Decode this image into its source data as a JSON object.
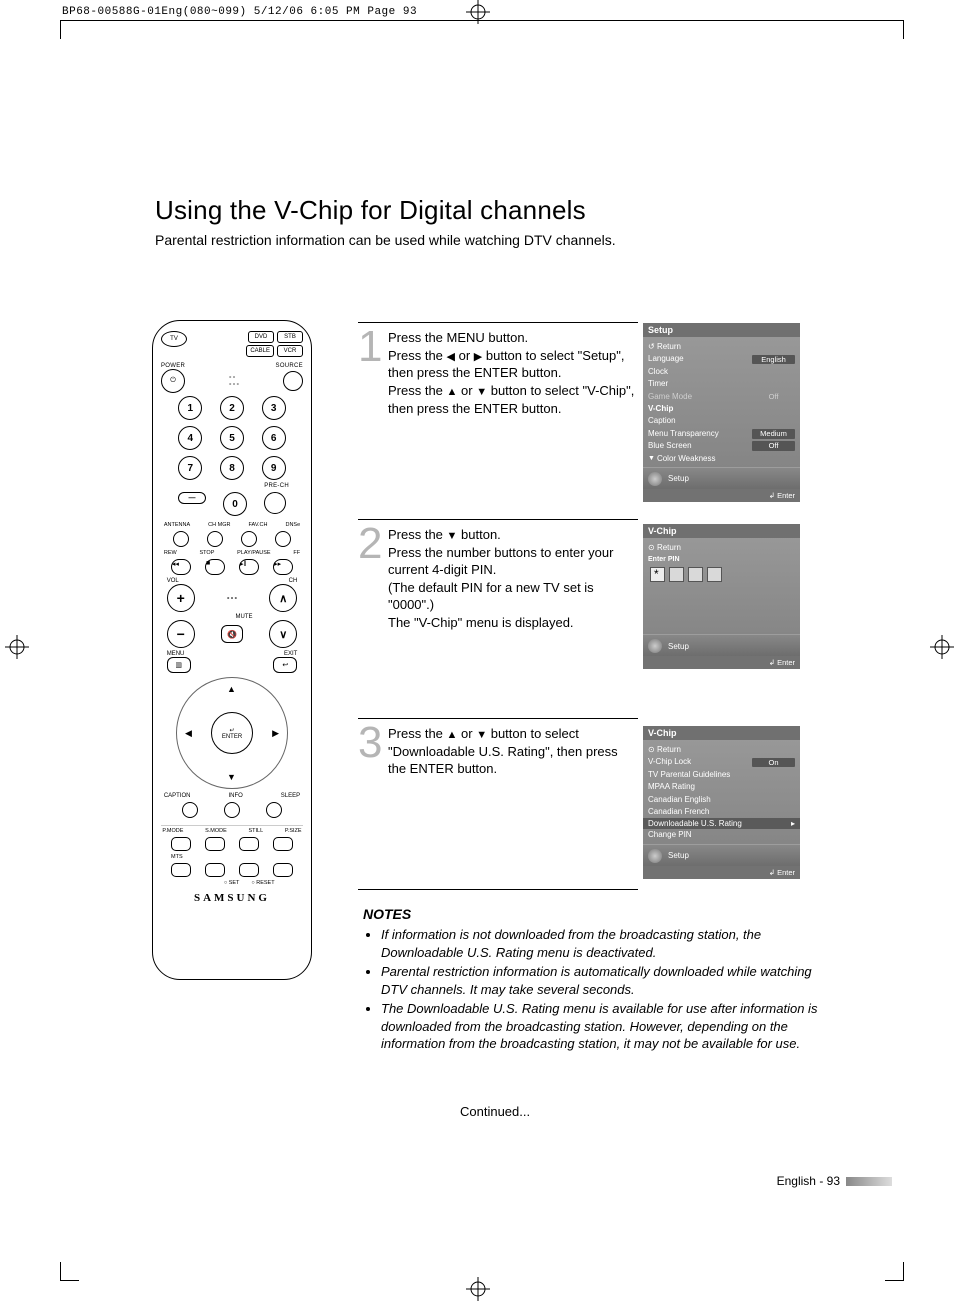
{
  "header": {
    "slug": "BP68-00588G-01Eng(080~099)  5/12/06  6:05 PM  Page 93"
  },
  "title": "Using the V-Chip for Digital channels",
  "subtitle": "Parental restriction information can be used while watching DTV channels.",
  "remote": {
    "tv": "TV",
    "dvd": "DVD",
    "stb": "STB",
    "cable": "CABLE",
    "vcr": "VCR",
    "power": "POWER",
    "source": "SOURCE",
    "prech": "PRE-CH",
    "row_small": {
      "antenna": "ANTENNA",
      "chmgr": "CH MGR",
      "favch": "FAV.CH",
      "dnse": "DNSe"
    },
    "transport": {
      "rew": "REW",
      "stop": "STOP",
      "playpause": "PLAY/PAUSE",
      "ff": "FF"
    },
    "vol": "VOL",
    "ch": "CH",
    "mute": "MUTE",
    "menu": "MENU",
    "exit": "EXIT",
    "enter": "ENTER",
    "caption": "CAPTION",
    "info": "INFO",
    "sleep": "SLEEP",
    "pmode": "P.MODE",
    "smode": "S.MODE",
    "still": "STILL",
    "psize": "P.SIZE",
    "mts": "MTS",
    "set": "SET",
    "reset": "RESET",
    "brand": "SAMSUNG"
  },
  "steps": {
    "s1_num": "1",
    "s1_l1": "Press the MENU button.",
    "s1_l2a": "Press the ",
    "s1_l2b": " or ",
    "s1_l2c": " button to select \"Setup\", then press the ENTER button.",
    "s1_l3a": "Press the ",
    "s1_l3b": " or ",
    "s1_l3c": " button to select \"V-Chip\", then press the ENTER button.",
    "s2_num": "2",
    "s2_l1a": "Press the ",
    "s2_l1b": " button.",
    "s2_l2": "Press the number buttons to enter your current 4-digit PIN.",
    "s2_l3": "(The default PIN for a new TV set is \"0000\".)",
    "s2_l4": "The \"V-Chip\" menu is displayed.",
    "s3_num": "3",
    "s3_l1a": "Press the ",
    "s3_l1b": " or ",
    "s3_l1c": " button to select \"Downloadable U.S. Rating\", then press the ENTER button."
  },
  "osd1": {
    "title": "Setup",
    "return": "Return",
    "language": "Language",
    "language_val": "English",
    "clock": "Clock",
    "timer": "Timer",
    "game": "Game Mode",
    "game_val": "Off",
    "vchip": "V-Chip",
    "caption": "Caption",
    "mtrans": "Menu Transparency",
    "mtrans_val": "Medium",
    "blue": "Blue Screen",
    "blue_val": "Off",
    "colorw": "Color Weakness",
    "setup": "Setup",
    "enter": "Enter"
  },
  "osd2": {
    "title": "V-Chip",
    "return": "Return",
    "enterpin": "Enter PIN",
    "setup": "Setup",
    "enter": "Enter"
  },
  "osd3": {
    "title": "V-Chip",
    "return": "Return",
    "lock": "V-Chip Lock",
    "lock_val": "On",
    "tvpg": "TV Parental Guidelines",
    "mpaa": "MPAA Rating",
    "caneng": "Canadian English",
    "canfr": "Canadian French",
    "dlus": "Downloadable U.S. Rating",
    "chpin": "Change PIN",
    "setup": "Setup",
    "enter": "Enter"
  },
  "notes": {
    "title": "NOTES",
    "n1": "If information is not downloaded from the broadcasting station, the Downloadable U.S. Rating menu is deactivated.",
    "n2": "Parental restriction information is automatically downloaded while watching DTV channels. It may take several seconds.",
    "n3": "The Downloadable U.S. Rating menu is available for use after information is downloaded from the broadcasting station. However, depending on the information from the broadcasting station, it may not be available for use."
  },
  "continued": "Continued...",
  "pagefoot": "English - 93"
}
